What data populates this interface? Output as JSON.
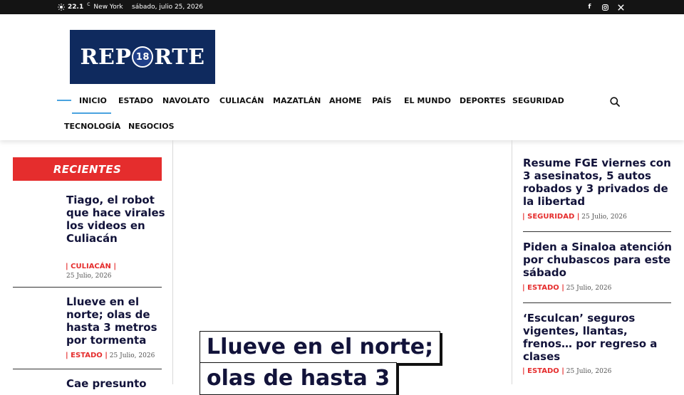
{
  "topbar": {
    "temperature": "22.1",
    "unit": "C",
    "city": "New York",
    "date": "sábado, julio 25, 2026",
    "social": [
      "facebook-icon",
      "instagram-icon",
      "x-icon"
    ]
  },
  "logo": {
    "text_left": "REP",
    "badge": "18",
    "text_right": "RTE"
  },
  "nav": {
    "items": [
      "INICIO",
      "ESTADO",
      "NAVOLATO",
      "CULIACÁN",
      "MAZATLÁN",
      "AHOME",
      "PAÍS",
      "EL MUNDO",
      "DEPORTES",
      "SEGURIDAD",
      "TECNOLOGÍA",
      "NEGOCIOS"
    ]
  },
  "left": {
    "header": "RECIENTES",
    "articles": [
      {
        "title": "Tiago, el robot que hace virales los videos en Culiacán",
        "category": "CULIACÁN",
        "date": "25 Julio, 2026"
      },
      {
        "title": "Llueve en el norte; olas de hasta 3 metros por tormenta",
        "category": "ESTADO",
        "date": "25 Julio, 2026"
      },
      {
        "title": "Cae presunto"
      }
    ]
  },
  "hero": {
    "line1": "Llueve en el norte;",
    "line2": "olas de hasta 3"
  },
  "right": {
    "articles": [
      {
        "title": "Resume FGE viernes con 3 asesinatos, 5 autos robados y 3 privados de la libertad",
        "category": "SEGURIDAD",
        "date": "25 Julio, 2026"
      },
      {
        "title": "Piden a Sinaloa atención por chubascos para este sábado",
        "category": "ESTADO",
        "date": "25 Julio, 2026"
      },
      {
        "title": "‘Esculcan’ seguros vigentes, llantas, frenos… por regreso a clases",
        "category": "ESTADO",
        "date": "25 Julio, 2026"
      }
    ]
  },
  "colors": {
    "accent": "#e52d2d",
    "nav_active": "#4aa3df",
    "logo_bg": "#0f2a5e",
    "title": "#12133a"
  }
}
